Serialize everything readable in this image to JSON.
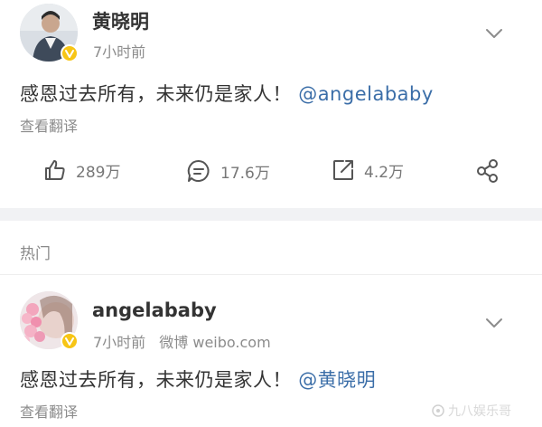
{
  "post1": {
    "username": "黄晓明",
    "time": "7小时前",
    "text_main": "感恩过去所有，未来仍是家人！",
    "mention": "@angelababy",
    "translate": "查看翻译",
    "actions": {
      "likes": "289万",
      "comments": "17.6万",
      "reposts": "4.2万"
    }
  },
  "section": {
    "label": "热门"
  },
  "post2": {
    "username": "angelababy",
    "time": "7小时前",
    "source": "微博 weibo.com",
    "text_main": "感恩过去所有，未来仍是家人！",
    "mention": "@黄晓明",
    "translate": "查看翻译"
  },
  "watermark": {
    "text": "九八娱乐哥"
  },
  "colors": {
    "mention": "#3b6ea8",
    "verified_badge": "#f7c515",
    "muted_text": "#8c8c8c",
    "divider": "#f1f2f4"
  }
}
